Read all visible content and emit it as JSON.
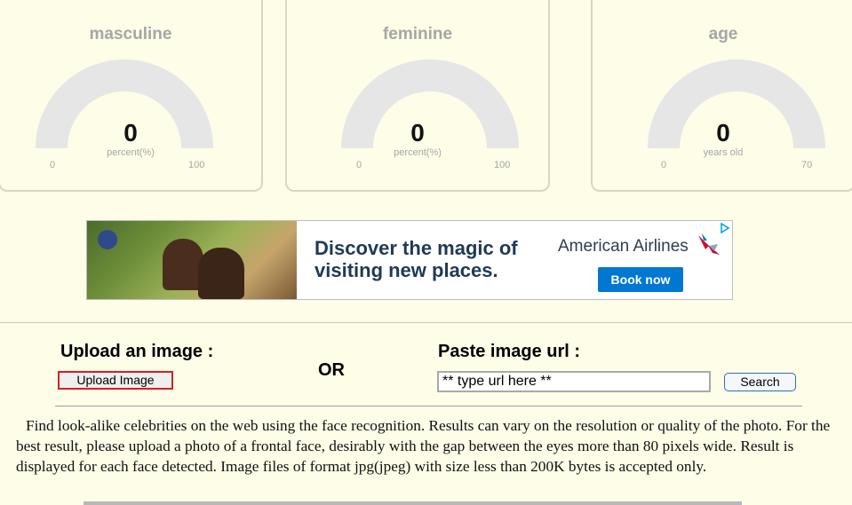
{
  "gauges": [
    {
      "title": "masculine",
      "value": "0",
      "unit": "percent(%)",
      "min": "0",
      "max": "100",
      "level": 0
    },
    {
      "title": "feminine",
      "value": "0",
      "unit": "percent(%)",
      "min": "0",
      "max": "100",
      "level": 0
    },
    {
      "title": "age",
      "value": "0",
      "unit": "years old",
      "min": "0",
      "max": "70",
      "level": 0
    }
  ],
  "ad": {
    "headline_line1": "Discover the magic of",
    "headline_line2": "visiting new places.",
    "brand": "American Airlines",
    "cta": "Book now",
    "cta_color": "#0078d2"
  },
  "upload": {
    "label": "Upload an image :",
    "button_label": "Upload Image"
  },
  "or_label": "OR",
  "url": {
    "label": "Paste image url :",
    "placeholder": "** type url here **",
    "search_label": "Search"
  },
  "description": "Find look-alike celebrities on the web using the face recognition. Results can vary on the resolution or quality of the photo. For the best result, please upload a photo of a frontal face, desirably with the gap between the eyes more than 80 pixels wide. Result is displayed for each face detected. Image files of format jpg(jpeg) with size less than 200K bytes is accepted only."
}
